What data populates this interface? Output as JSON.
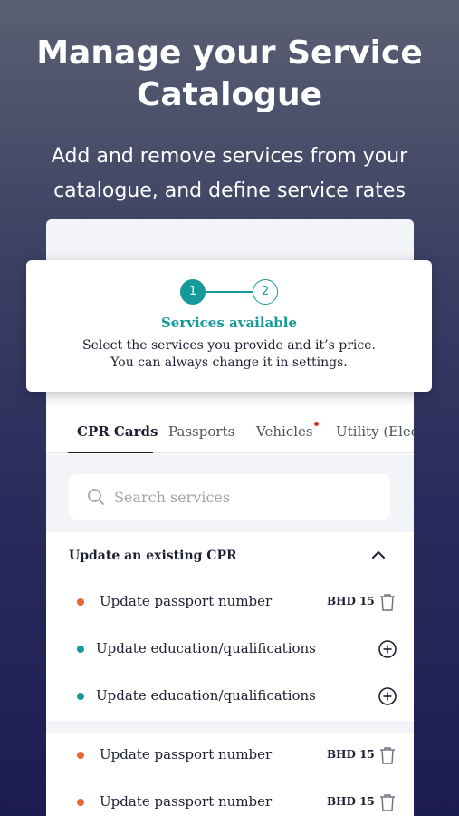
{
  "hero": {
    "title_line1": "Manage your Service",
    "title_line2": "Catalogue",
    "subtitle_line1": "Add and remove services from your",
    "subtitle_line2": "catalogue, and define service rates"
  },
  "stepper": {
    "step1": "1",
    "step2": "2",
    "current_step": 1,
    "title": "Services available",
    "desc_line1": "Select the services you provide and it’s price.",
    "desc_line2": "You can always change it in settings."
  },
  "tabs": [
    {
      "label": "CPR Cards",
      "active": true
    },
    {
      "label": "Passports",
      "active": false
    },
    {
      "label": "Vehicles",
      "active": false,
      "has_notification": true
    },
    {
      "label": "Utility (Elec",
      "active": false
    }
  ],
  "search": {
    "placeholder": "Search services",
    "icon": "search-icon"
  },
  "section": {
    "title": "Update an existing CPR",
    "expanded": true,
    "icon": "chevron-up-icon"
  },
  "services_group1": [
    {
      "label": "Update passport number",
      "status_color": "#e8643a",
      "price": "BHD 15",
      "action": "trash-icon"
    },
    {
      "label": "Update education/qualifications",
      "status_color": "#15999a",
      "price": "",
      "action": "add-circle-icon"
    },
    {
      "label": "Update education/qualifications",
      "status_color": "#15999a",
      "price": "",
      "action": "add-circle-icon"
    }
  ],
  "services_group2": [
    {
      "label": "Update passport number",
      "status_color": "#e8643a",
      "price": "BHD 15",
      "action": "trash-icon"
    },
    {
      "label": "Update passport number",
      "status_color": "#e8643a",
      "price": "BHD 15",
      "action": "trash-icon"
    }
  ],
  "colors": {
    "accent": "#15999a",
    "removable_dot": "#e8643a",
    "notification": "#d32f2f"
  }
}
